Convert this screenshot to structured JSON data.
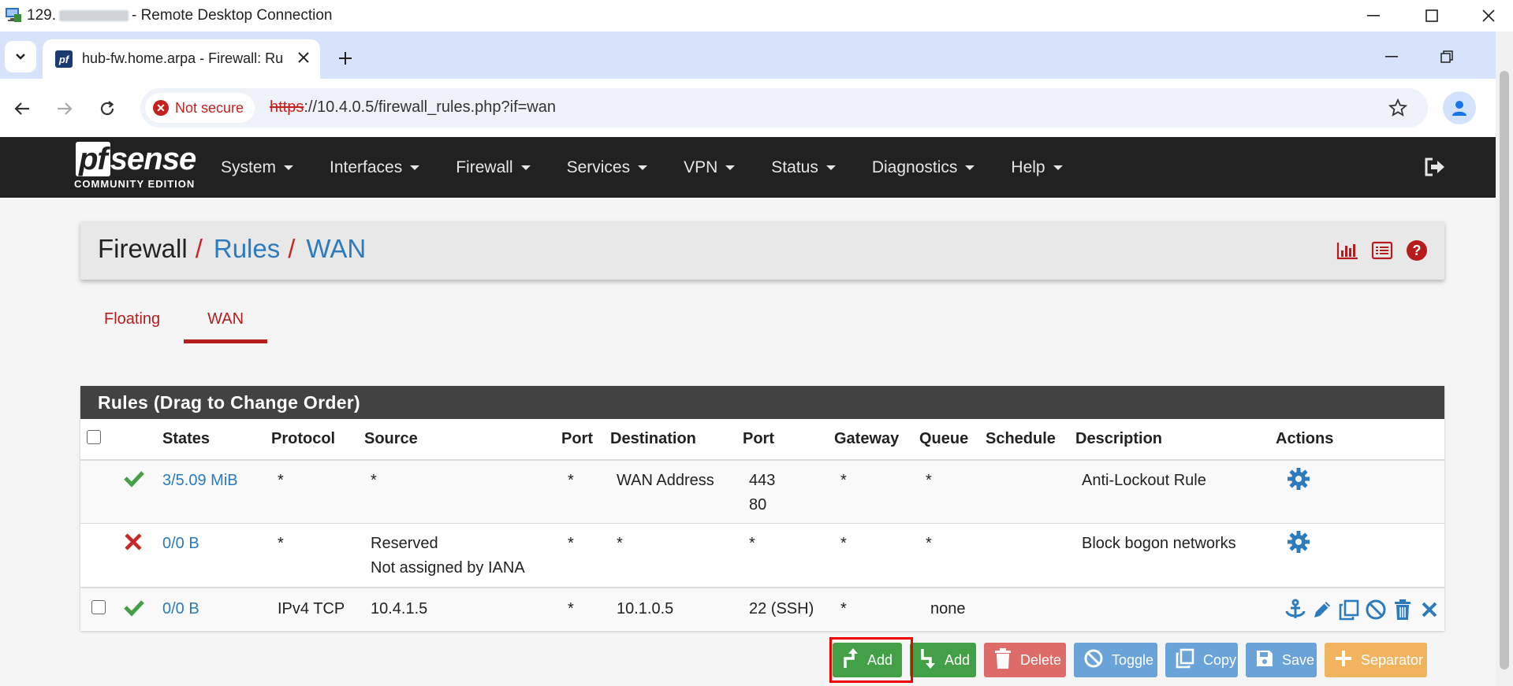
{
  "rdp": {
    "title_prefix": "129.",
    "title_suffix": "- Remote Desktop Connection"
  },
  "browser": {
    "tab_title": "hub-fw.home.arpa - Firewall: Ru",
    "favicon_text": "pf",
    "security_chip": "Not secure",
    "url_scheme": "https",
    "url_rest": "://10.4.0.5/firewall_rules.php?if=wan"
  },
  "pfsense": {
    "logo_mark_pf": "pf",
    "logo_mark_rest": "sense",
    "logo_edition": "COMMUNITY EDITION",
    "menu": [
      "System",
      "Interfaces",
      "Firewall",
      "Services",
      "VPN",
      "Status",
      "Diagnostics",
      "Help"
    ]
  },
  "breadcrumb": {
    "root": "Firewall",
    "sep": "/",
    "level1": "Rules",
    "level2": "WAN"
  },
  "tabs": [
    "Floating",
    "WAN"
  ],
  "active_tab": "WAN",
  "panel": {
    "title": "Rules (Drag to Change Order)",
    "columns": [
      "States",
      "Protocol",
      "Source",
      "Port",
      "Destination",
      "Port",
      "Gateway",
      "Queue",
      "Schedule",
      "Description",
      "Actions"
    ],
    "rows": [
      {
        "status": "pass",
        "states": "3/5.09 MiB",
        "protocol": "*",
        "source": "*",
        "source2": "",
        "sport": "*",
        "destination": "WAN Address",
        "dport": "443",
        "dport2": "80",
        "gateway": "*",
        "queue": "*",
        "schedule": "",
        "description": "Anti-Lockout Rule"
      },
      {
        "status": "block",
        "states": "0/0 B",
        "protocol": "*",
        "source": "Reserved",
        "source2": "Not assigned by IANA",
        "sport": "*",
        "destination": "*",
        "dport": "*",
        "dport2": "",
        "gateway": "*",
        "queue": "*",
        "schedule": "",
        "description": "Block bogon networks"
      },
      {
        "status": "pass",
        "states": "0/0 B",
        "protocol": "IPv4 TCP",
        "source": "10.4.1.5",
        "source2": "",
        "sport": "*",
        "destination": "10.1.0.5",
        "dport": "22 (SSH)",
        "dport2": "",
        "gateway": "*",
        "queue": "none",
        "schedule": "",
        "description": ""
      }
    ]
  },
  "buttons": {
    "add_top": "Add",
    "add_bottom": "Add",
    "delete": "Delete",
    "toggle": "Toggle",
    "copy": "Copy",
    "save": "Save",
    "separator": "Separator"
  },
  "colors": {
    "pass": "#43a047",
    "block": "#c62828",
    "link": "#2b7bbd",
    "nav_bg": "#212121"
  }
}
